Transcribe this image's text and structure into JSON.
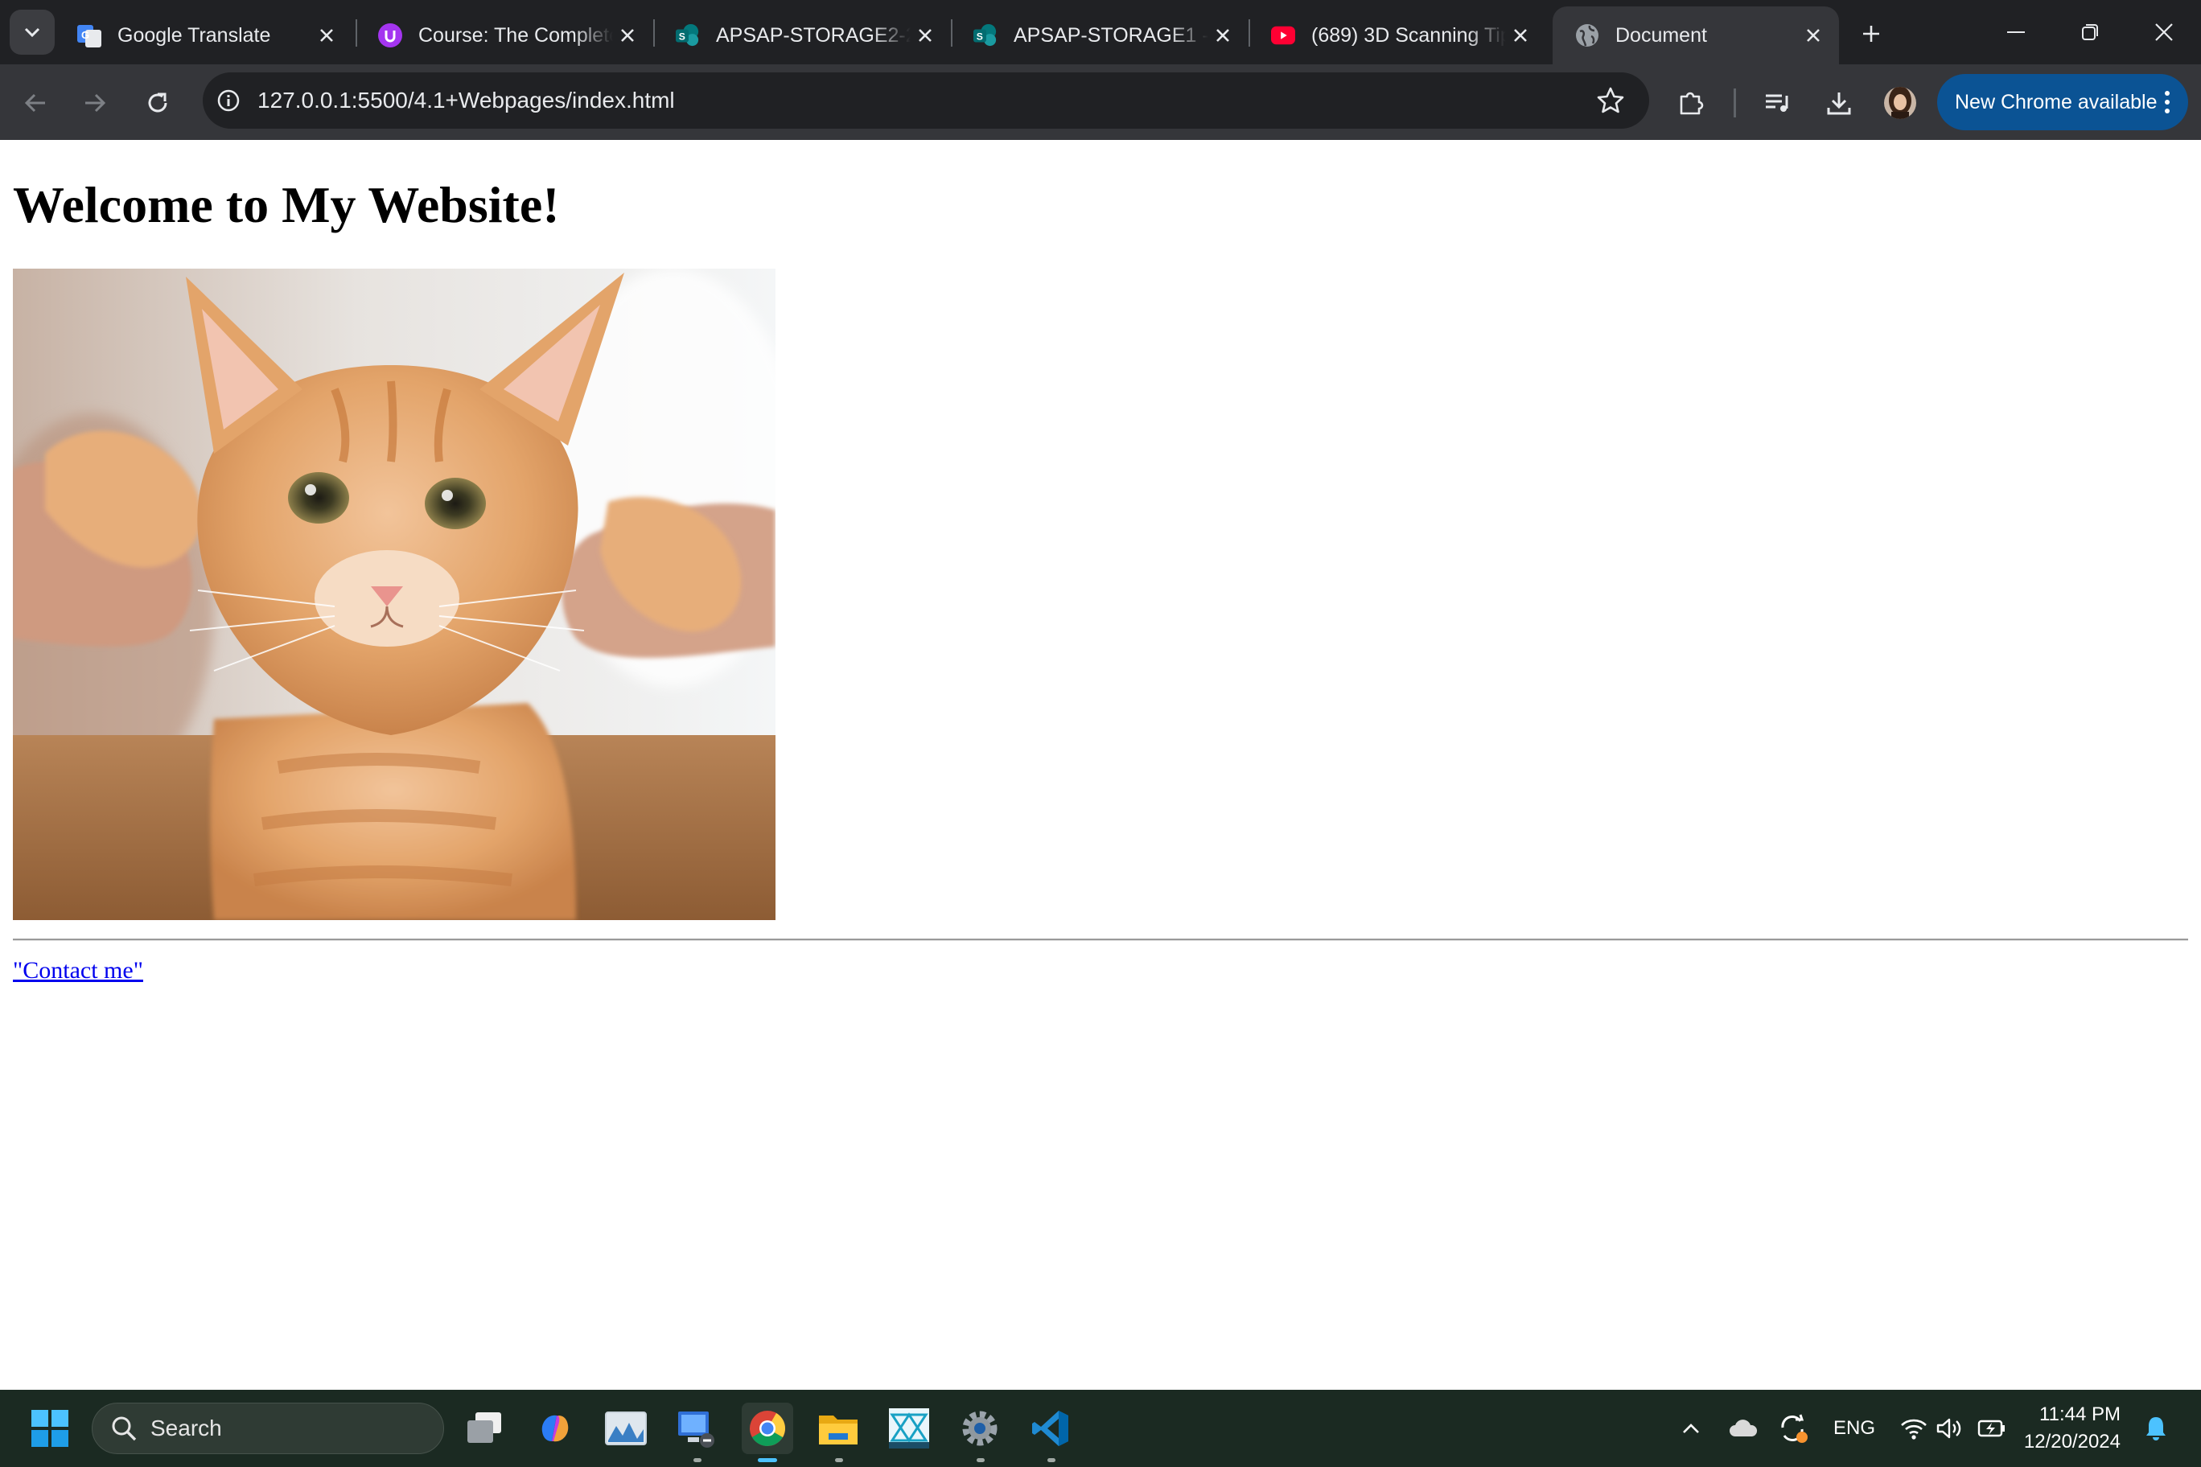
{
  "browser": {
    "tabs": [
      {
        "title": "Google Translate",
        "favicon": "google-translate-icon",
        "active": false
      },
      {
        "title": "Course: The Complete",
        "favicon": "udemy-icon",
        "active": false
      },
      {
        "title": "APSAP-STORAGE2-20",
        "favicon": "sharepoint-icon",
        "active": false
      },
      {
        "title": "APSAP-STORAGE1 - n",
        "favicon": "sharepoint-icon",
        "active": false
      },
      {
        "title": "(689) 3D Scanning Tip",
        "favicon": "youtube-icon",
        "active": false
      },
      {
        "title": "Document",
        "favicon": "globe-icon",
        "active": true
      }
    ],
    "address": {
      "url": "127.0.0.1:5500/4.1+Webpages/index.html"
    },
    "update_button_label": "New Chrome available",
    "colors": {
      "frame": "#202124",
      "toolbar": "#35363a",
      "update": "#0b5394"
    }
  },
  "page": {
    "heading": "Welcome to My Website!",
    "image_description": "orange-tabby-kitten",
    "link_text": "\"Contact me\"",
    "link_color": "#0000ee"
  },
  "taskbar": {
    "search_label": "Search",
    "apps": [
      "task-view-icon",
      "copilot-icon",
      "photos-icon",
      "remote-desktop-icon",
      "chrome-icon",
      "file-explorer-icon",
      "app-icon",
      "settings-icon",
      "vscode-icon"
    ],
    "language": "ENG",
    "time": "11:44 PM",
    "date": "12/20/2024"
  }
}
